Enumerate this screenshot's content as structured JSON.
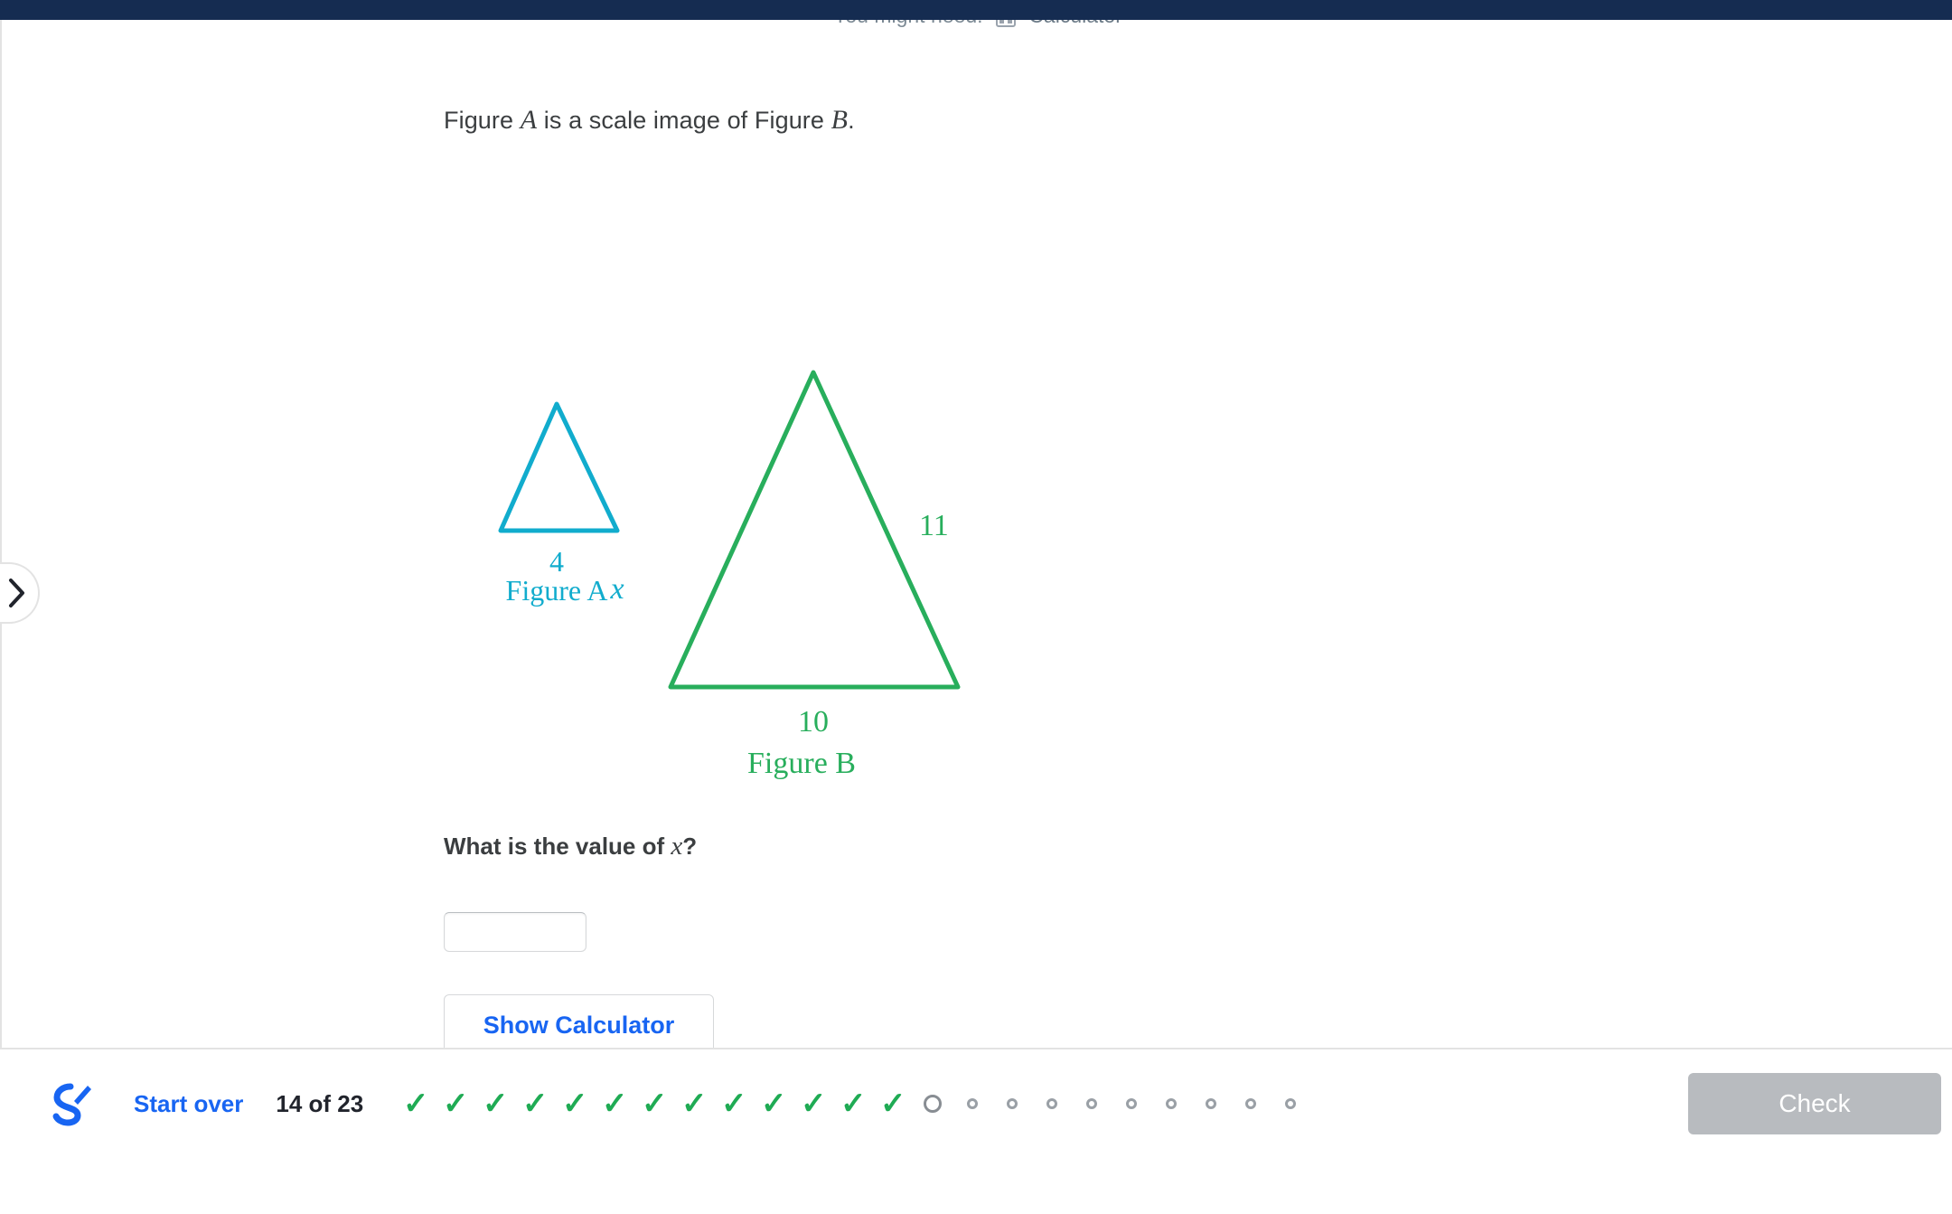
{
  "header": {
    "hint_prefix": "You might need:",
    "calculator_label": "Calculator",
    "calculator_icon": "calculator-icon"
  },
  "problem": {
    "statement_part1": "Figure ",
    "statement_var_a": "A",
    "statement_part2": " is a scale image of Figure ",
    "statement_var_b": "B",
    "statement_part3": ".",
    "subquestion_part1": "What is the value of ",
    "subquestion_var": "x",
    "subquestion_part2": "?"
  },
  "figures": {
    "figure_a": {
      "label": "Figure A",
      "base_label": "4",
      "side_label": "x",
      "color": "#11accd"
    },
    "figure_b": {
      "label": "Figure B",
      "base_label": "10",
      "side_label": "11",
      "color": "#28ae5c"
    }
  },
  "answer": {
    "value": "",
    "placeholder": ""
  },
  "buttons": {
    "show_calculator": "Show Calculator",
    "check": "Check",
    "start_over": "Start over"
  },
  "progress": {
    "count_text": "14 of 23",
    "current_index": 14,
    "total": 23,
    "states": [
      "correct",
      "correct",
      "correct",
      "correct",
      "correct",
      "correct",
      "correct",
      "correct",
      "correct",
      "correct",
      "correct",
      "correct",
      "correct",
      "current",
      "future",
      "future",
      "future",
      "future",
      "future",
      "future",
      "future",
      "future",
      "future"
    ]
  },
  "nav": {
    "chevron_right_icon": "chevron-right-icon",
    "ka_logo_icon": "khan-academy-pencil-icon"
  },
  "colors": {
    "topbar": "#152c51",
    "link_blue": "#1865f2",
    "correct_green": "#1fab54",
    "figure_a": "#11accd",
    "figure_b": "#28ae5c",
    "disabled_gray": "#b8bbbf"
  }
}
